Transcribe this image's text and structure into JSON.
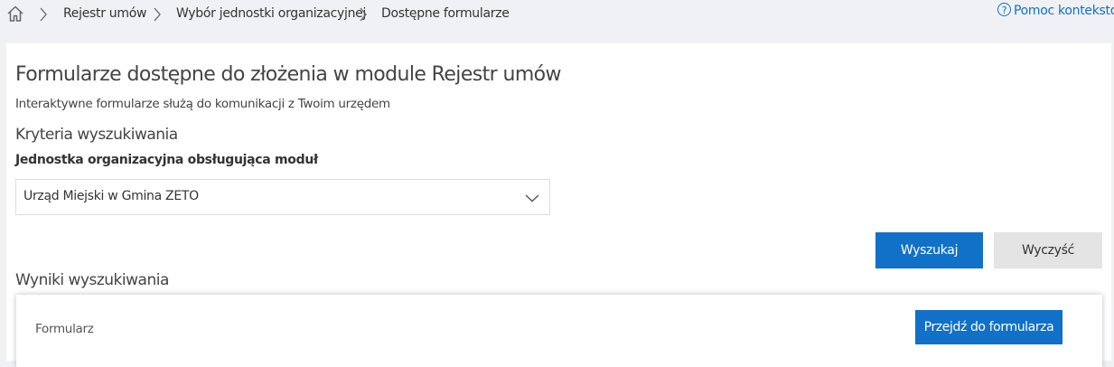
{
  "breadcrumb": {
    "items": [
      "Rejestr umów",
      "Wybór jednostki organizacyjnej",
      "Dostępne formularze"
    ],
    "help_label": "Pomoc kontekstowa"
  },
  "header": {
    "title": "Formularze dostępne do złożenia w module Rejestr umów",
    "subtitle": "Interaktywne formularze służą do komunikacji z Twoim urzędem"
  },
  "search": {
    "section_title": "Kryteria wyszukiwania",
    "unit_label": "Jednostka organizacyjna obsługująca moduł",
    "unit_selected": "Urząd Miejski w Gmina ZETO",
    "search_button": "Wyszukaj",
    "clear_button": "Wyczyść"
  },
  "results": {
    "section_title": "Wyniki wyszukiwania",
    "items": [
      {
        "name": "Formularz",
        "action": "Przejdź do formularza"
      }
    ]
  },
  "colors": {
    "accent": "#1170c7",
    "background": "#eff1f4",
    "secondary_button": "#e4e4e4"
  },
  "icons": [
    "home-icon",
    "chevron-right-icon",
    "help-circle-icon",
    "chevron-down-icon"
  ]
}
